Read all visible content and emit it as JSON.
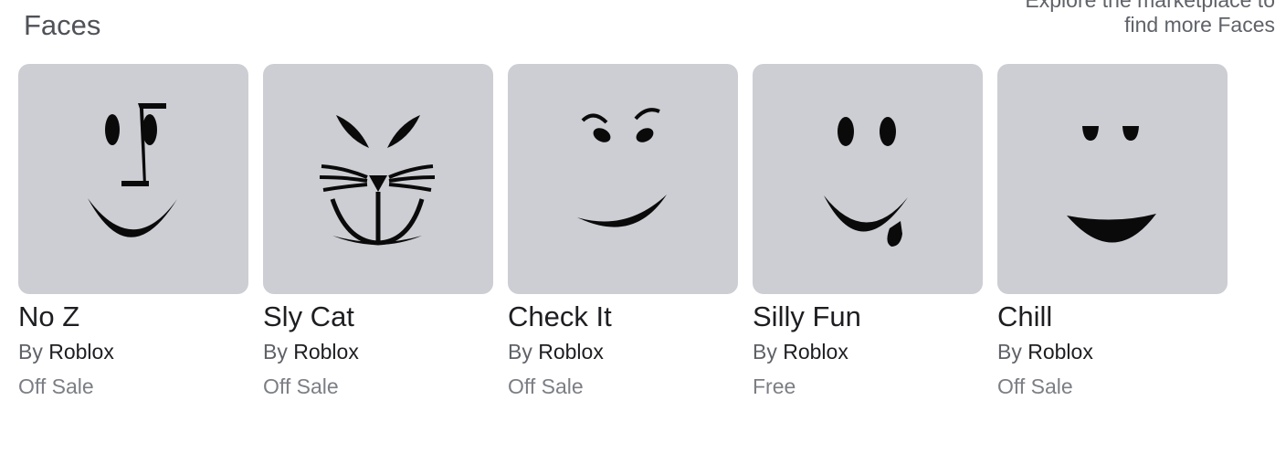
{
  "section": {
    "title": "Faces",
    "explore_line1": "Explore the marketplace to",
    "explore_line2": "find more Faces"
  },
  "items": [
    {
      "name": "No Z",
      "by_label": "By",
      "creator": "Roblox",
      "price": "Off Sale",
      "icon": "no-z-face-icon"
    },
    {
      "name": "Sly Cat",
      "by_label": "By",
      "creator": "Roblox",
      "price": "Off Sale",
      "icon": "sly-cat-face-icon"
    },
    {
      "name": "Check It",
      "by_label": "By",
      "creator": "Roblox",
      "price": "Off Sale",
      "icon": "check-it-face-icon"
    },
    {
      "name": "Silly Fun",
      "by_label": "By",
      "creator": "Roblox",
      "price": "Free",
      "icon": "silly-fun-face-icon"
    },
    {
      "name": "Chill",
      "by_label": "By",
      "creator": "Roblox",
      "price": "Off Sale",
      "icon": "chill-face-icon"
    }
  ],
  "colors": {
    "thumbnail_bg": "#cdced3",
    "title_text": "#1d1e21",
    "secondary_text": "#5f6268",
    "price_text": "#7b7e84"
  }
}
